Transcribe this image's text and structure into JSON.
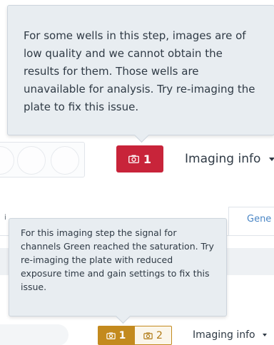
{
  "top": {
    "tooltip_text": "For some wells in this step, images are of low quality and we cannot obtain the results for them. Those wells are unavailable for analysis. Try re-imaging the plate to fix this issue.",
    "badge_icon": "camera-icon",
    "badge_count": "1",
    "badge_color": "#c8243a",
    "imaging_info_label": "Imaging info"
  },
  "bottom": {
    "tab_label": "Gene",
    "tooltip_text": "For this imaging step the signal for channels Green reached the saturation. Try re-imaging the plate with reduced exposure time and gain settings to fix this issue.",
    "badge_filled_count": "1",
    "badge_outline_count": "2",
    "badge_color": "#c38a1e",
    "imaging_info_label": "Imaging info"
  }
}
